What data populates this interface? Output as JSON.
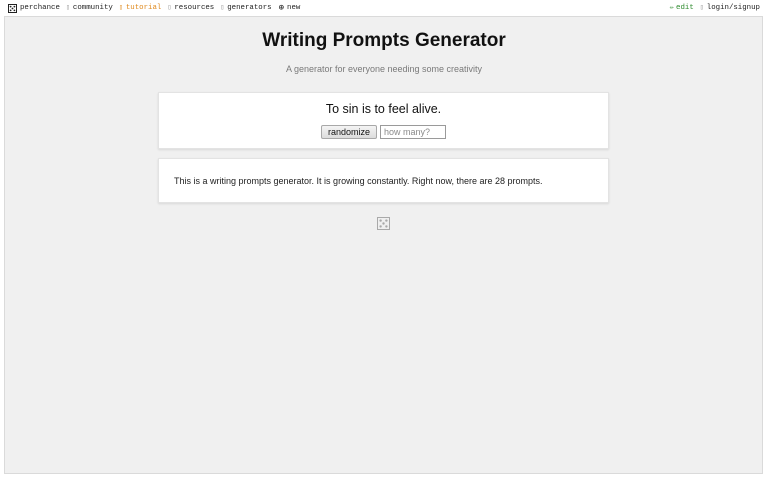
{
  "nav": {
    "left": [
      {
        "label": "perchance",
        "icon": "perchance-die-icon"
      },
      {
        "label": "community",
        "icon": "community-icon"
      },
      {
        "label": "tutorial",
        "icon": "tutorial-icon"
      },
      {
        "label": "resources",
        "icon": "resources-icon"
      },
      {
        "label": "generators",
        "icon": "generators-icon"
      },
      {
        "label": "new",
        "icon": "plus-circle-icon"
      }
    ],
    "right": [
      {
        "label": "edit",
        "icon": "pencil-icon"
      },
      {
        "label": "login/signup",
        "icon": "user-icon"
      }
    ]
  },
  "page": {
    "title": "Writing Prompts Generator",
    "subtitle": "A generator for everyone needing some creativity"
  },
  "output": {
    "prompt": "To sin is to feel alive.",
    "randomize_label": "randomize",
    "count_placeholder": "how many?"
  },
  "info": {
    "text": "This is a writing prompts generator. It is growing constantly. Right now, there are 28 prompts."
  },
  "footer": {
    "icon": "perchance-die-icon"
  },
  "colors": {
    "tutorial": "#e08a1e",
    "edit": "#2e8b2e",
    "frame_bg": "#f0f0f0"
  }
}
